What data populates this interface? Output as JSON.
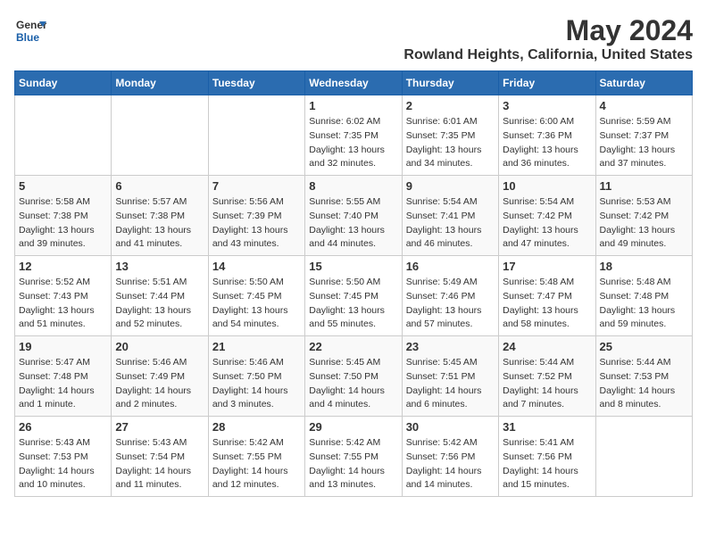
{
  "logo": {
    "general": "General",
    "blue": "Blue"
  },
  "title": "May 2024",
  "location": "Rowland Heights, California, United States",
  "headers": [
    "Sunday",
    "Monday",
    "Tuesday",
    "Wednesday",
    "Thursday",
    "Friday",
    "Saturday"
  ],
  "weeks": [
    [
      {
        "day": "",
        "info": ""
      },
      {
        "day": "",
        "info": ""
      },
      {
        "day": "",
        "info": ""
      },
      {
        "day": "1",
        "info": "Sunrise: 6:02 AM\nSunset: 7:35 PM\nDaylight: 13 hours and 32 minutes."
      },
      {
        "day": "2",
        "info": "Sunrise: 6:01 AM\nSunset: 7:35 PM\nDaylight: 13 hours and 34 minutes."
      },
      {
        "day": "3",
        "info": "Sunrise: 6:00 AM\nSunset: 7:36 PM\nDaylight: 13 hours and 36 minutes."
      },
      {
        "day": "4",
        "info": "Sunrise: 5:59 AM\nSunset: 7:37 PM\nDaylight: 13 hours and 37 minutes."
      }
    ],
    [
      {
        "day": "5",
        "info": "Sunrise: 5:58 AM\nSunset: 7:38 PM\nDaylight: 13 hours and 39 minutes."
      },
      {
        "day": "6",
        "info": "Sunrise: 5:57 AM\nSunset: 7:38 PM\nDaylight: 13 hours and 41 minutes."
      },
      {
        "day": "7",
        "info": "Sunrise: 5:56 AM\nSunset: 7:39 PM\nDaylight: 13 hours and 43 minutes."
      },
      {
        "day": "8",
        "info": "Sunrise: 5:55 AM\nSunset: 7:40 PM\nDaylight: 13 hours and 44 minutes."
      },
      {
        "day": "9",
        "info": "Sunrise: 5:54 AM\nSunset: 7:41 PM\nDaylight: 13 hours and 46 minutes."
      },
      {
        "day": "10",
        "info": "Sunrise: 5:54 AM\nSunset: 7:42 PM\nDaylight: 13 hours and 47 minutes."
      },
      {
        "day": "11",
        "info": "Sunrise: 5:53 AM\nSunset: 7:42 PM\nDaylight: 13 hours and 49 minutes."
      }
    ],
    [
      {
        "day": "12",
        "info": "Sunrise: 5:52 AM\nSunset: 7:43 PM\nDaylight: 13 hours and 51 minutes."
      },
      {
        "day": "13",
        "info": "Sunrise: 5:51 AM\nSunset: 7:44 PM\nDaylight: 13 hours and 52 minutes."
      },
      {
        "day": "14",
        "info": "Sunrise: 5:50 AM\nSunset: 7:45 PM\nDaylight: 13 hours and 54 minutes."
      },
      {
        "day": "15",
        "info": "Sunrise: 5:50 AM\nSunset: 7:45 PM\nDaylight: 13 hours and 55 minutes."
      },
      {
        "day": "16",
        "info": "Sunrise: 5:49 AM\nSunset: 7:46 PM\nDaylight: 13 hours and 57 minutes."
      },
      {
        "day": "17",
        "info": "Sunrise: 5:48 AM\nSunset: 7:47 PM\nDaylight: 13 hours and 58 minutes."
      },
      {
        "day": "18",
        "info": "Sunrise: 5:48 AM\nSunset: 7:48 PM\nDaylight: 13 hours and 59 minutes."
      }
    ],
    [
      {
        "day": "19",
        "info": "Sunrise: 5:47 AM\nSunset: 7:48 PM\nDaylight: 14 hours and 1 minute."
      },
      {
        "day": "20",
        "info": "Sunrise: 5:46 AM\nSunset: 7:49 PM\nDaylight: 14 hours and 2 minutes."
      },
      {
        "day": "21",
        "info": "Sunrise: 5:46 AM\nSunset: 7:50 PM\nDaylight: 14 hours and 3 minutes."
      },
      {
        "day": "22",
        "info": "Sunrise: 5:45 AM\nSunset: 7:50 PM\nDaylight: 14 hours and 4 minutes."
      },
      {
        "day": "23",
        "info": "Sunrise: 5:45 AM\nSunset: 7:51 PM\nDaylight: 14 hours and 6 minutes."
      },
      {
        "day": "24",
        "info": "Sunrise: 5:44 AM\nSunset: 7:52 PM\nDaylight: 14 hours and 7 minutes."
      },
      {
        "day": "25",
        "info": "Sunrise: 5:44 AM\nSunset: 7:53 PM\nDaylight: 14 hours and 8 minutes."
      }
    ],
    [
      {
        "day": "26",
        "info": "Sunrise: 5:43 AM\nSunset: 7:53 PM\nDaylight: 14 hours and 10 minutes."
      },
      {
        "day": "27",
        "info": "Sunrise: 5:43 AM\nSunset: 7:54 PM\nDaylight: 14 hours and 11 minutes."
      },
      {
        "day": "28",
        "info": "Sunrise: 5:42 AM\nSunset: 7:55 PM\nDaylight: 14 hours and 12 minutes."
      },
      {
        "day": "29",
        "info": "Sunrise: 5:42 AM\nSunset: 7:55 PM\nDaylight: 14 hours and 13 minutes."
      },
      {
        "day": "30",
        "info": "Sunrise: 5:42 AM\nSunset: 7:56 PM\nDaylight: 14 hours and 14 minutes."
      },
      {
        "day": "31",
        "info": "Sunrise: 5:41 AM\nSunset: 7:56 PM\nDaylight: 14 hours and 15 minutes."
      },
      {
        "day": "",
        "info": ""
      }
    ]
  ]
}
